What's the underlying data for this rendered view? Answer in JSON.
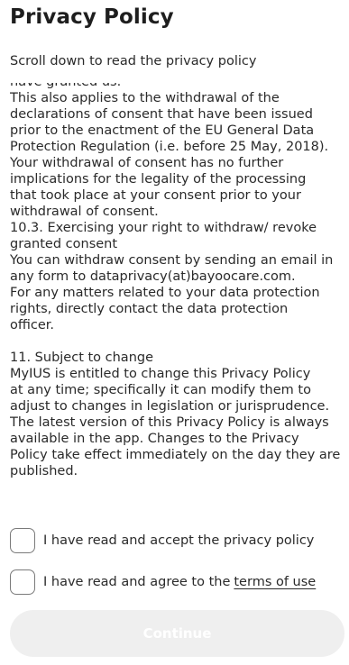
{
  "header": {
    "title": "Privacy Policy",
    "subtitle": "Scroll down to read the privacy policy"
  },
  "policy": {
    "lines": [
      "have granted us.",
      "This also applies to the withdrawal of the",
      "declarations of consent that have been issued",
      "prior to the enactment of the EU General Data",
      "Protection Regulation (i.e. before 25 May, 2018).",
      "Your withdrawal of consent has no further",
      "implications for the legality of the processing",
      "that took place at your consent prior to your",
      "withdrawal of consent.",
      "10.3. Exercising your right to withdraw/ revoke",
      "granted consent",
      "You can withdraw consent by sending an email in",
      "any form to dataprivacy(at)bayoocare.com.",
      "For any matters related to your data protection",
      "rights, directly contact the data protection",
      "officer.",
      "",
      "11. Subject to change",
      "MyIUS is entitled to change this Privacy Policy",
      "at any time; specifically it can modify them to",
      "adjust to changes in legislation or jurisprudence.",
      "The latest version of this Privacy Policy is always",
      "available in the app. Changes to the Privacy",
      "Policy take effect immediately on the day they are",
      "published."
    ]
  },
  "consents": {
    "privacy_label": "I have read and accept the privacy policy",
    "privacy_checked": false,
    "terms_label": "I have read and agree to the",
    "terms_link": "terms of use",
    "terms_checked": false
  },
  "actions": {
    "continue_label": "Continue",
    "continue_enabled": false
  },
  "colors": {
    "text": "#2a2a2a",
    "button_disabled_bg": "#efefef",
    "checkbox_border": "#7a7a7a"
  }
}
